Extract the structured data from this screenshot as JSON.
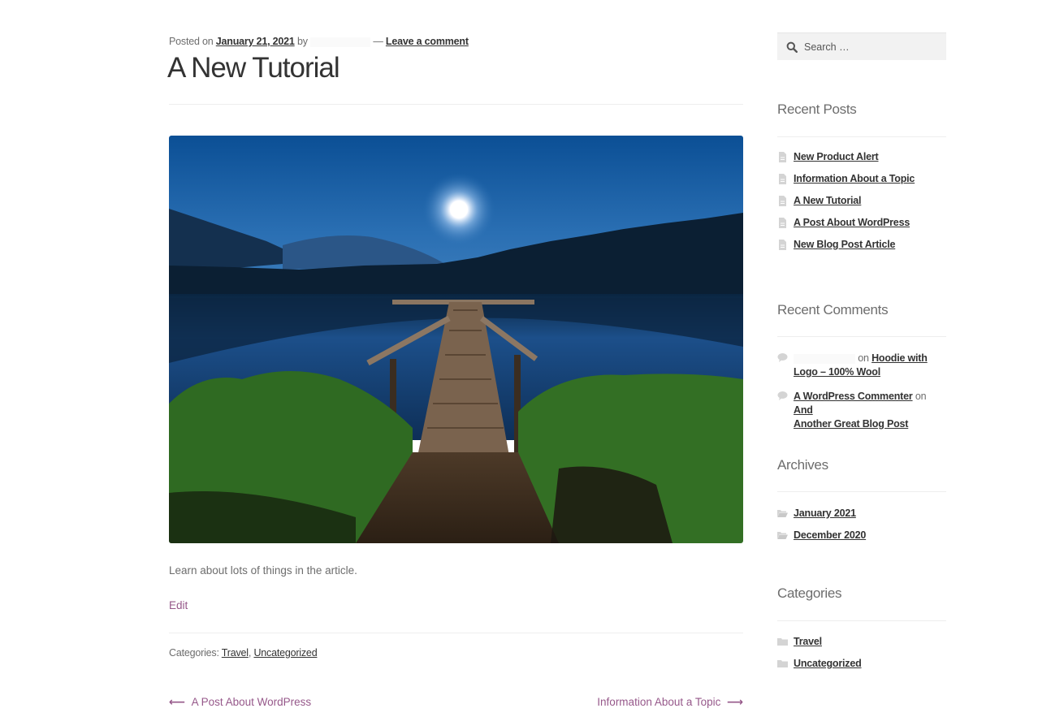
{
  "post": {
    "meta": {
      "posted_on_label": "Posted on",
      "date": "January 21, 2021",
      "by_label": "by",
      "separator": "—",
      "comment_link": "Leave a comment"
    },
    "title": "A New Tutorial",
    "featured_image": {
      "description": "Night landscape: moon over a mountain lake with a wooden dock and grass in foreground",
      "colors": {
        "sky": "#1e62a6",
        "water": "#163f70",
        "grass": "#3f7a26"
      }
    },
    "excerpt": "Learn about lots of things in the article.",
    "edit_label": "Edit",
    "categories_label": "Categories:",
    "categories": [
      "Travel",
      "Uncategorized"
    ],
    "categories_sep": ",",
    "navigation": {
      "previous": {
        "arrow": "⟵",
        "label": "A Post About WordPress"
      },
      "next": {
        "arrow": "⟶",
        "label": "Information About a Topic"
      }
    }
  },
  "sidebar": {
    "search": {
      "placeholder": "Search …",
      "value": ""
    },
    "recent_posts": {
      "title": "Recent Posts",
      "items": [
        "New Product Alert",
        "Information About a Topic",
        "A New Tutorial",
        "A Post About WordPress",
        "New Blog Post Article"
      ]
    },
    "recent_comments": {
      "title": "Recent Comments",
      "on_label": "on",
      "items": [
        {
          "author": "",
          "post_line1": "Hoodie with",
          "post_line2": "Logo – 100% Wool"
        },
        {
          "author": "A WordPress Commenter",
          "post_line1": "And",
          "post_line2": "Another Great Blog Post"
        }
      ]
    },
    "archives": {
      "title": "Archives",
      "items": [
        "January 2021",
        "December 2020"
      ]
    },
    "categories": {
      "title": "Categories",
      "items": [
        "Travel",
        "Uncategorized"
      ]
    }
  },
  "colors": {
    "accent": "#96588a",
    "text": "#6d6d6d",
    "heading": "#333333",
    "divider": "#eeeeee",
    "search_bg": "#f2f2f2"
  }
}
